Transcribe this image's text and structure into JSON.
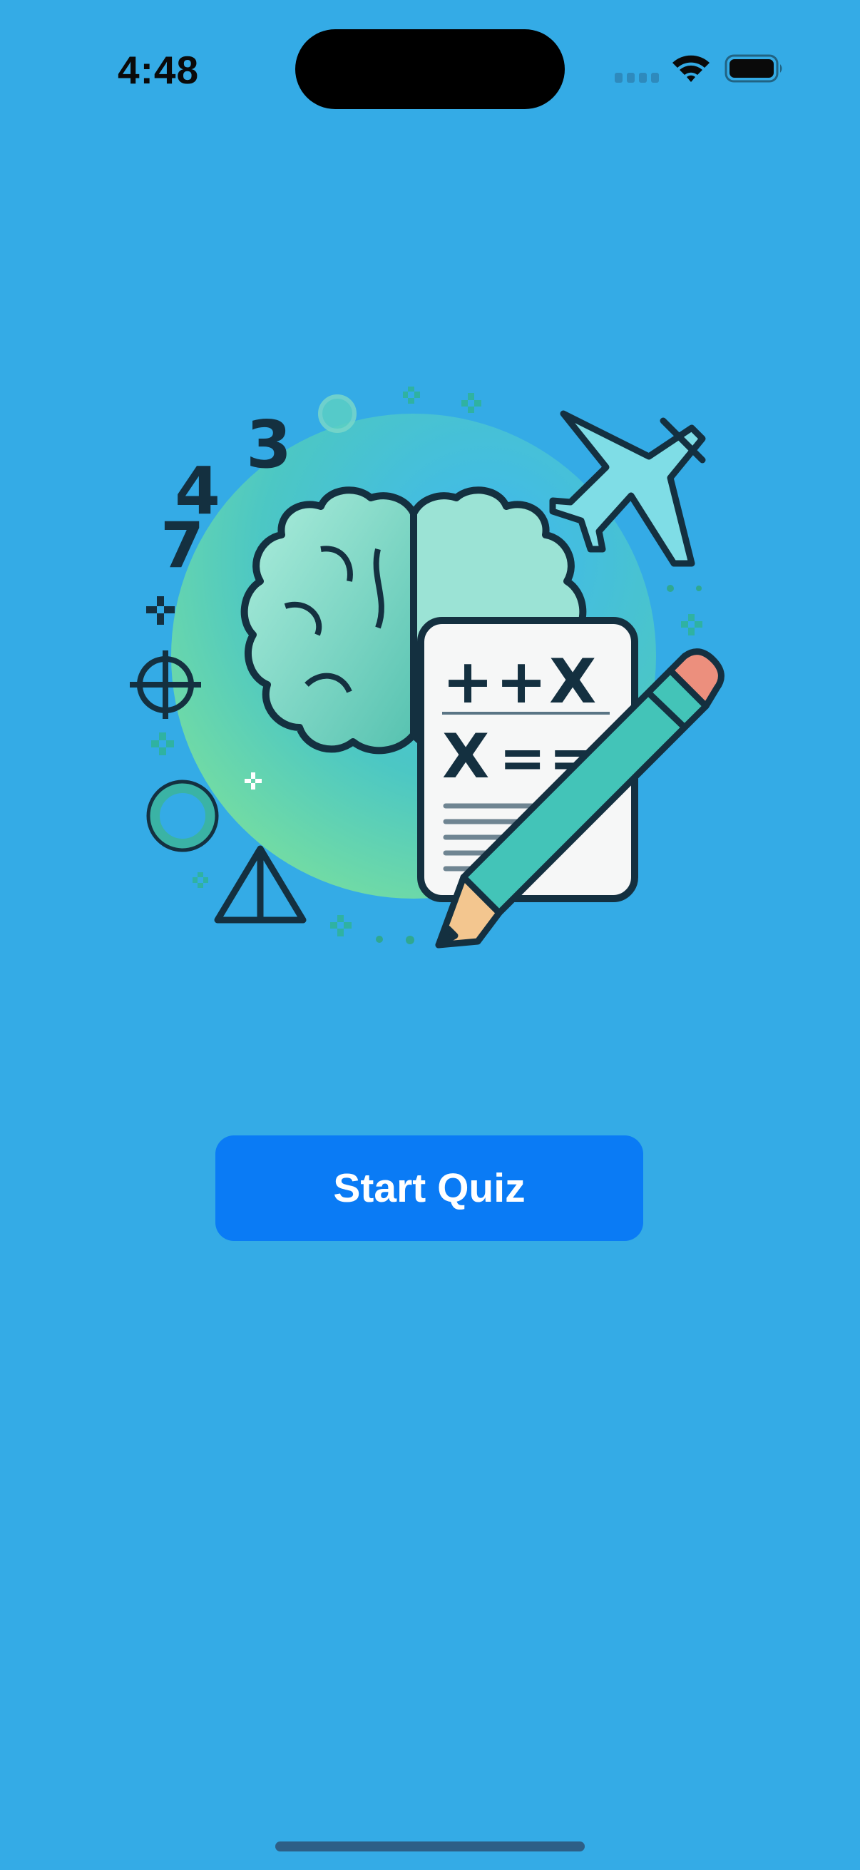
{
  "status_bar": {
    "time": "4:48",
    "icons": [
      "cellular-signal-icon",
      "wifi-icon",
      "battery-icon"
    ]
  },
  "illustration": {
    "subject": "brain-quiz-illustration",
    "numbers": [
      "3",
      "4",
      "7"
    ],
    "worksheet_symbols": [
      "+",
      "+",
      "X",
      "X",
      "=",
      "="
    ]
  },
  "main": {
    "start_button_label": "Start Quiz"
  },
  "colors": {
    "background": "#34abe6",
    "button": "#0a7bf5",
    "button_text": "#ffffff"
  }
}
